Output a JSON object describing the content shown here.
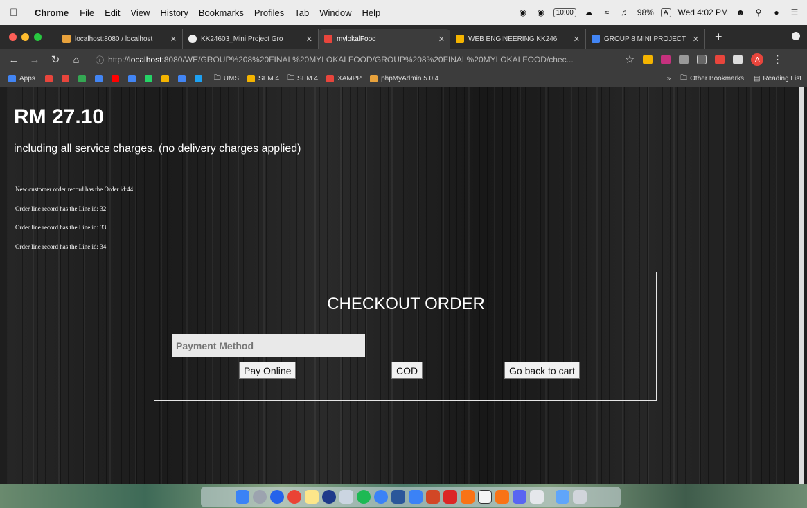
{
  "menubar": {
    "app": "Chrome",
    "menus": [
      "File",
      "Edit",
      "View",
      "History",
      "Bookmarks",
      "Profiles",
      "Tab",
      "Window",
      "Help"
    ],
    "time_box": "10:00",
    "battery": "98%",
    "input_source": "A",
    "clock": "Wed 4:02 PM"
  },
  "tabs": [
    {
      "title": "localhost:8080 / localhost",
      "color": "#e8a23c"
    },
    {
      "title": "KK24603_Mini Project Gro",
      "color": "#eeeeee"
    },
    {
      "title": "mylokalFood",
      "color": "#e8453c"
    },
    {
      "title": "WEB ENGINEERING KK246",
      "color": "#f4b400"
    },
    {
      "title": "GROUP 8 MINI PROJECT |",
      "color": "#4285f4"
    }
  ],
  "address": {
    "prefix": "http://",
    "host": "localhost",
    "path": ":8080/WE/GROUP%208%20FINAL%20MYLOKALFOOD/GROUP%208%20FINAL%20MYLOKALFOOD/chec..."
  },
  "bookmarks": {
    "apps": "Apps",
    "items": [
      "UMS",
      "SEM 4",
      "SEM 4",
      "XAMPP",
      "phpMyAdmin 5.0.4"
    ],
    "more": "»",
    "other": "Other Bookmarks",
    "reading": "Reading List"
  },
  "page": {
    "total": "RM 27.10",
    "charges": "including all service charges. (no delivery charges applied)",
    "records": [
      "New customer order record has the Order id:44",
      "Order line record has the Line id: 32",
      "Order line record has the Line id: 33",
      "Order line record has the Line id: 34"
    ],
    "checkout": {
      "title": "CHECKOUT ORDER",
      "payment_placeholder": "Payment Method",
      "pay_online": "Pay Online",
      "cod": "COD",
      "back": "Go back to cart"
    }
  },
  "colors": {
    "accent_red": "#e8453c",
    "text_white": "#ffffff"
  }
}
